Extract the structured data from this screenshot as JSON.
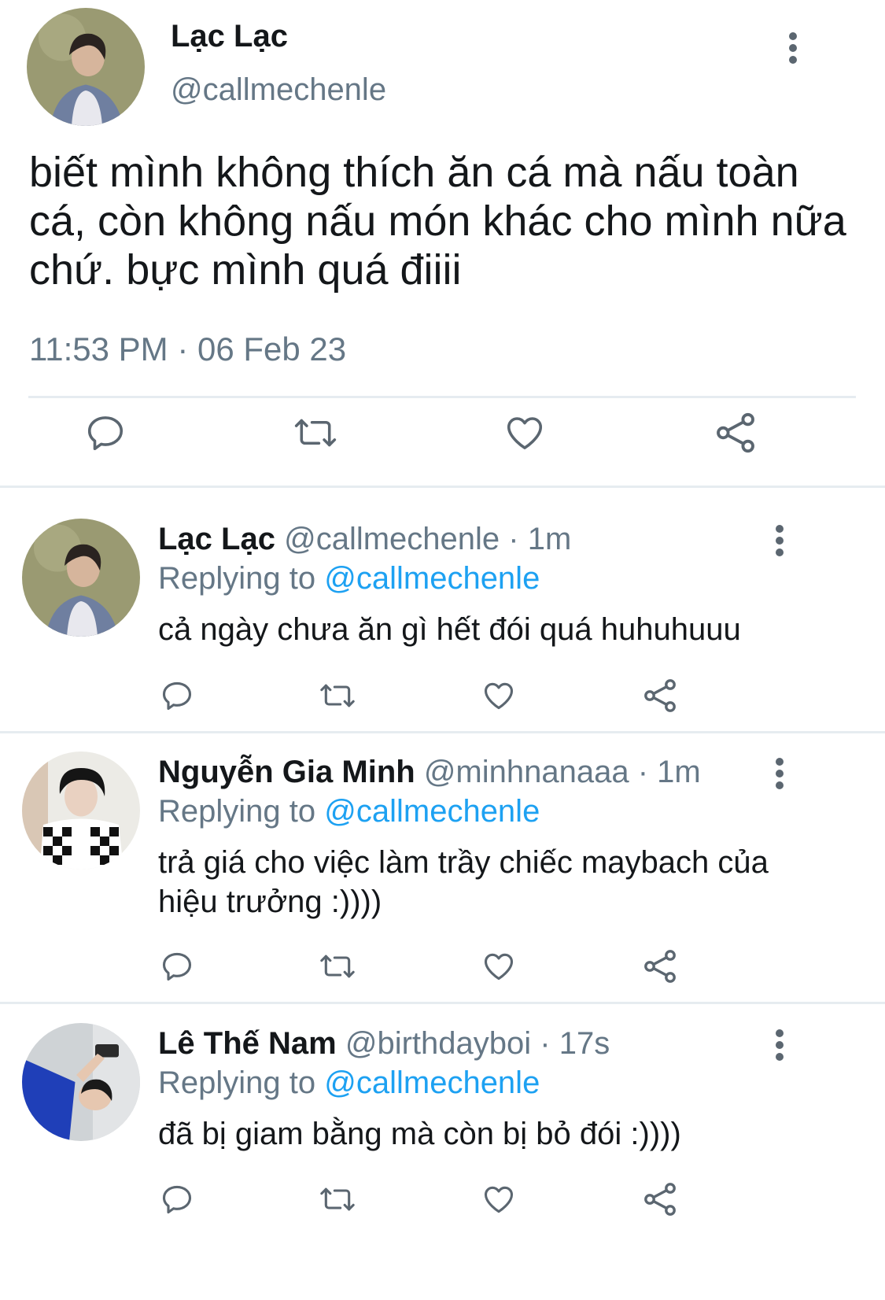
{
  "main_tweet": {
    "display_name": "Lạc Lạc",
    "handle": "@callmechenle",
    "text": "biết mình không thích ăn cá mà nấu toàn cá, còn không nấu món khác cho mình nữa chứ. bực mình quá điiii",
    "timestamp": "11:53 PM · 06 Feb 23"
  },
  "replies": [
    {
      "display_name": "Lạc Lạc",
      "handle": "@callmechenle",
      "separator": "·",
      "time": "1m",
      "replying_prefix": "Replying to",
      "replying_to": "@callmechenle",
      "text": "cả ngày chưa ăn gì hết đói quá huhuhuuu"
    },
    {
      "display_name": "Nguyễn Gia Minh",
      "handle": "@minhnanaaa",
      "separator": "·",
      "time": "1m",
      "replying_prefix": "Replying to",
      "replying_to": "@callmechenle",
      "text": "trả giá cho việc làm trầy chiếc maybach của hiệu trưởng :))))"
    },
    {
      "display_name": "Lê Thế Nam",
      "handle": "@birthdayboi",
      "separator": "·",
      "time": "17s",
      "replying_prefix": "Replying to",
      "replying_to": "@callmechenle",
      "text": "đã bị giam bằng mà còn bị bỏ đói :))))"
    }
  ],
  "action_icons": [
    "reply-icon",
    "retweet-icon",
    "like-icon",
    "share-icon"
  ],
  "colors": {
    "text": "#14171a",
    "muted": "#657786",
    "accent": "#1da1f2",
    "icon": "#5b6670",
    "divider": "#e6ecf0"
  }
}
